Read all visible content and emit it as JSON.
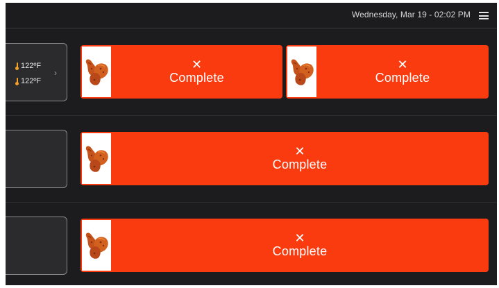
{
  "header": {
    "datetime": "Wednesday, Mar 19 - 02:02 PM",
    "menu_icon": "hamburger-menu-icon"
  },
  "fryers": [
    {
      "temps": [
        "122ºF",
        "122ºF"
      ],
      "temp_icon": "thermometer-icon",
      "chevron": "›"
    },
    {
      "temps": []
    },
    {
      "temps": []
    }
  ],
  "tiles": [
    {
      "label": "Complete",
      "close_glyph": "✕",
      "image": "chicken-wings-icon"
    },
    {
      "label": "Complete",
      "close_glyph": "✕",
      "image": "chicken-wings-icon"
    },
    {
      "label": "Complete",
      "close_glyph": "✕",
      "image": "chicken-wings-icon"
    },
    {
      "label": "Complete",
      "close_glyph": "✕",
      "image": "chicken-wings-icon"
    }
  ],
  "colors": {
    "background": "#1c1c1e",
    "tile_accent": "#fa3b0f",
    "thermometer": "#f3a128"
  }
}
